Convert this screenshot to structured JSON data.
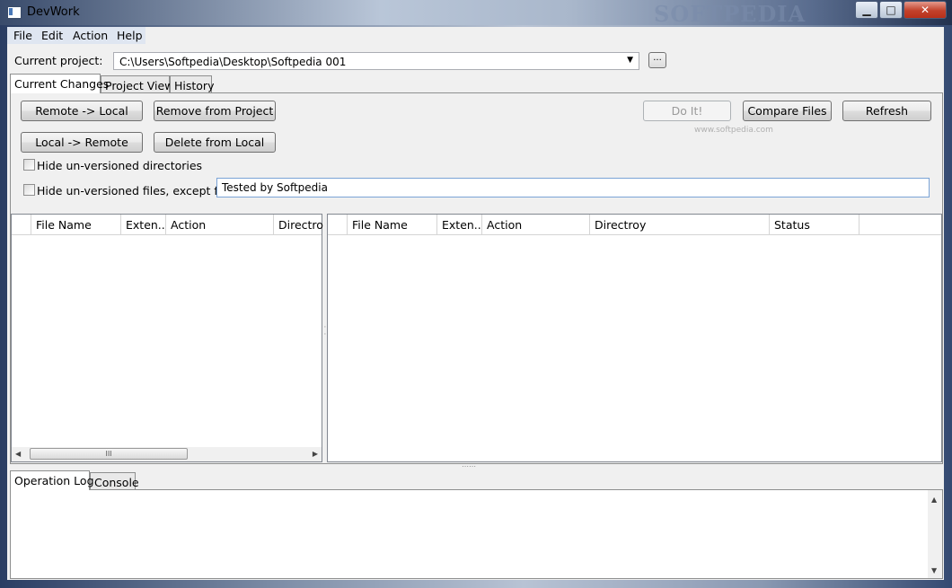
{
  "window": {
    "title": "DevWork",
    "watermark": "SOFTPEDIA",
    "minimize_glyph": "▁",
    "maximize_glyph": "□",
    "close_glyph": "✕"
  },
  "menu": {
    "file": "File",
    "edit": "Edit",
    "action": "Action",
    "help": "Help"
  },
  "project": {
    "label": "Current project:",
    "value": "C:\\Users\\Softpedia\\Desktop\\Softpedia 001",
    "dropdown_glyph": "▼",
    "browse_label": "..."
  },
  "tabs": {
    "current_changes": "Current Changes",
    "project_view": "Project View",
    "history": "History"
  },
  "buttons": {
    "remote_to_local": "Remote -> Local",
    "remove_from_project": "Remove from Project",
    "local_to_remote": "Local -> Remote",
    "delete_from_local": "Delete from Local",
    "do_it": "Do It!",
    "compare_files": "Compare Files",
    "refresh": "Refresh"
  },
  "options": {
    "hide_dirs": "Hide un-versioned directories",
    "hide_files": "Hide un-versioned files, except for:",
    "except_value": "Tested by Softpedia"
  },
  "left_grid": {
    "columns": [
      "File Name",
      "Exten...",
      "Action",
      "Directroy"
    ],
    "thumb_glyph": "III",
    "left_arrow": "◀",
    "right_arrow": "▶"
  },
  "right_grid": {
    "columns": [
      "File Name",
      "Exten...",
      "Action",
      "Directroy",
      "Status"
    ]
  },
  "bottom_tabs": {
    "operation_log": "Operation Log",
    "console": "Console"
  },
  "log": {
    "up_arrow": "▲",
    "down_arrow": "▼"
  },
  "footer_watermark": "www.softpedia.com",
  "colors": {
    "title_bar": "#b9c6d8",
    "close_button": "#c2412b",
    "menu_bar": "#dfe6f1",
    "input_focus_border": "#7aa3d6"
  }
}
